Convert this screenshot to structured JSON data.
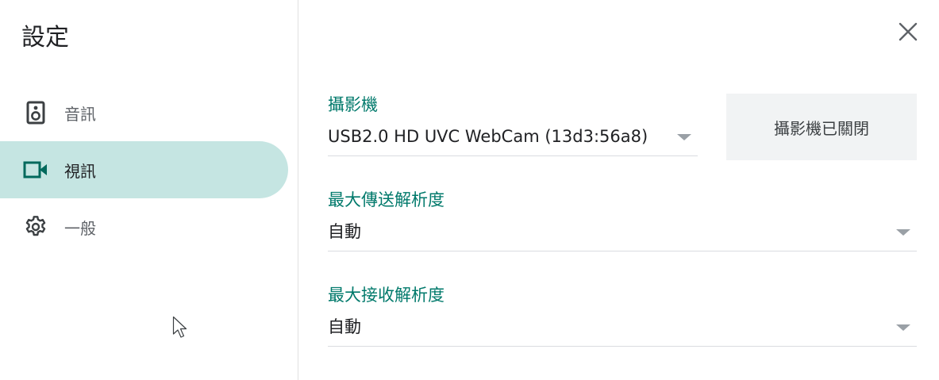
{
  "dialog": {
    "title": "設定",
    "close_icon": "close-icon"
  },
  "sidebar": {
    "items": [
      {
        "label": "音訊",
        "icon": "speaker-icon",
        "active": false
      },
      {
        "label": "視訊",
        "icon": "videocam-icon",
        "active": true
      },
      {
        "label": "一般",
        "icon": "gear-icon",
        "active": false
      }
    ]
  },
  "video": {
    "camera": {
      "label": "攝影機",
      "value": "USB2.0 HD UVC WebCam (13d3:56a8)"
    },
    "camera_toggle_label": "攝影機已關閉",
    "send_resolution": {
      "label": "最大傳送解析度",
      "value": "自動"
    },
    "receive_resolution": {
      "label": "最大接收解析度",
      "value": "自動"
    }
  },
  "colors": {
    "accent": "#00796b",
    "active_nav_bg": "#c5e5e2",
    "toggle_bg": "#f1f3f4"
  }
}
